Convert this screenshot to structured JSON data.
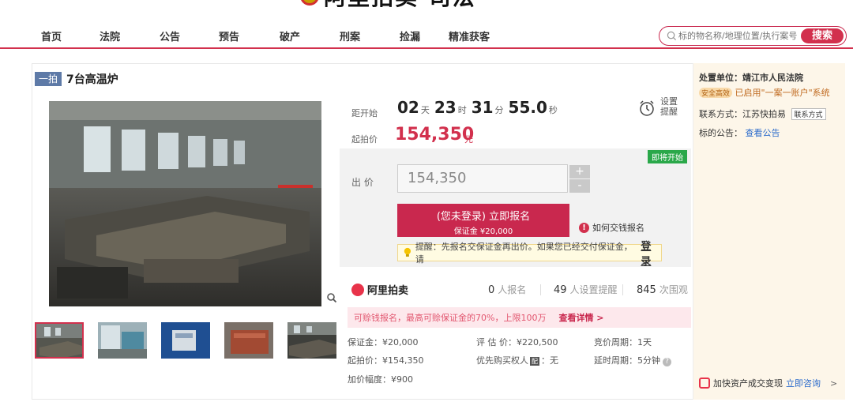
{
  "logo": {
    "text": "阿里拍卖·司法"
  },
  "nav": {
    "items": [
      "首页",
      "法院",
      "公告",
      "预告",
      "破产",
      "刑案",
      "捡漏",
      "精准获客"
    ]
  },
  "search": {
    "placeholder": "标的物名称/地理位置/执行案号",
    "button": "搜索"
  },
  "item": {
    "tag": "一拍",
    "title": "7台高温炉"
  },
  "countdown": {
    "label": "距开始",
    "days": "02",
    "days_unit": "天",
    "hours": "23",
    "hours_unit": "时",
    "minutes": "31",
    "minutes_unit": "分",
    "seconds": "55.0",
    "seconds_unit": "秒"
  },
  "reminder": {
    "label": "设置提醒"
  },
  "start": {
    "label": "起拍价",
    "price": "154,350",
    "unit": "元"
  },
  "bid": {
    "soon_badge": "即将开始",
    "label": "出 价",
    "value": "154,350",
    "plus": "+",
    "minus": "-",
    "signup_line1": "(您未登录) 立即报名",
    "signup_line2": "保证金 ¥20,000",
    "howto": "如何交钱报名",
    "tip_text": "提醒：先报名交保证金再出价。如果您已经交付保证金，请",
    "tip_login": "登录"
  },
  "stats": {
    "brand": "阿里拍卖",
    "signups_num": "0",
    "signups_label": "人报名",
    "reminders_num": "49",
    "reminders_label": "人设置提醒",
    "views_num": "845",
    "views_label": "次围观"
  },
  "promo": {
    "text": "可赊钱报名，最高可赊保证金的70%，上限100万",
    "more": "查看详情 >"
  },
  "info": {
    "deposit": "保证金：¥20,000",
    "appraisal": "评 估 价：¥220,500",
    "cycle": "竞价周期：1天",
    "start_price": "起拍价：¥154,350",
    "priority_prefix": "优先购买权人",
    "priority_badge": "配",
    "priority_value": "：无",
    "delay": "延时周期：5分钟",
    "increment": "加价幅度：¥900"
  },
  "right": {
    "court_label": "处置单位：靖江市人民法院",
    "safe_badge": "安全高效",
    "safe_text": "已启用\"一案一账户\"系统",
    "contact_label": "联系方式：江苏快拍易",
    "contact_btn": "联系方式",
    "notice_label": "标的公告：",
    "notice_link": "查看公告",
    "bottom_text": "加快资产成交变现",
    "bottom_link": "立即咨询",
    "bottom_arrow": ">"
  },
  "colors": {
    "accent": "#d2304d",
    "tag_bg": "#5e7aa7",
    "soon_green": "#2aa84a"
  }
}
